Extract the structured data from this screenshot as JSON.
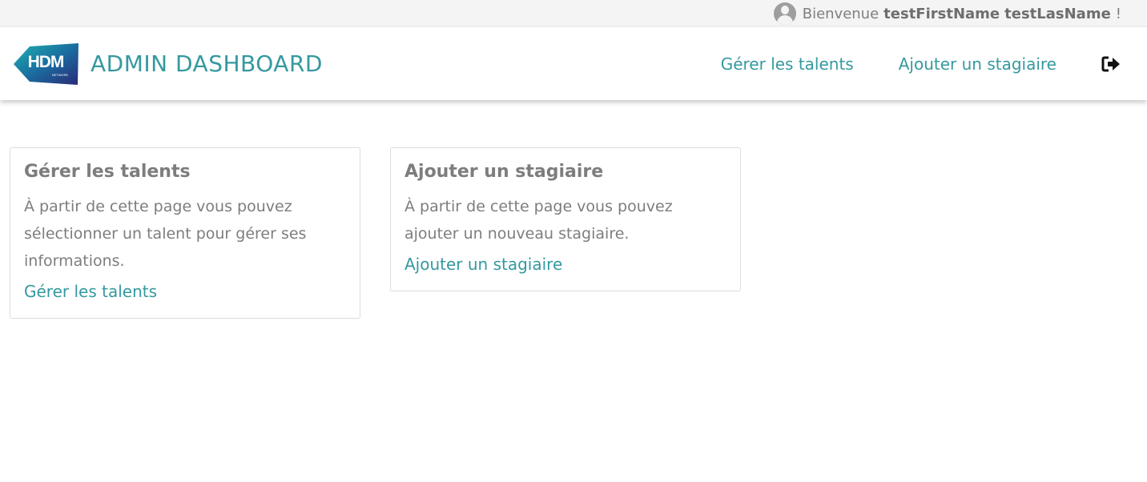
{
  "topbar": {
    "welcome": "Bienvenue",
    "first_name": "testFirstName",
    "last_name": "testLasName",
    "exclamation": "!"
  },
  "navbar": {
    "logo_text": "HDM",
    "logo_subtext": "NETWORK",
    "brand": "ADMIN DASHBOARD",
    "links": [
      {
        "label": "Gérer les talents"
      },
      {
        "label": "Ajouter un stagiaire"
      }
    ],
    "logout_icon": "sign-out-icon"
  },
  "cards": [
    {
      "title": "Gérer les talents",
      "text": "À partir de cette page vous pouvez sélectionner un talent pour gérer ses informations.",
      "link": "Gérer les talents"
    },
    {
      "title": "Ajouter un stagiaire",
      "text": "À partir de cette page vous pouvez ajouter un nouveau stagiaire.",
      "link": "Ajouter un stagiaire"
    }
  ],
  "colors": {
    "accent": "#35999f",
    "text_muted": "#7d7d7d",
    "topbar_bg": "#f4f4f4"
  }
}
